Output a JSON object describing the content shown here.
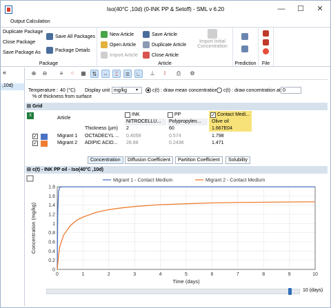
{
  "window": {
    "title": "Iso(40°C ,10d) (0-INK PP & Setoff) - SML v 6.20",
    "minimize": "—",
    "maximize": "☐",
    "close": "✕"
  },
  "ribbon_tabs": [
    "Output Calculation"
  ],
  "ribbon": {
    "package": {
      "label": "Package",
      "items": [
        "Duplicate Package",
        "Close Package",
        "Save Package As",
        "Save All Packages",
        "Package Details"
      ]
    },
    "article": {
      "label": "Article",
      "items": [
        "New Article",
        "Open Article",
        "Import Article",
        "Save Article",
        "Duplicate Article",
        "Close Article",
        "Import Initial Concentration"
      ]
    },
    "prediction": {
      "label": "Prediction"
    },
    "file": {
      "label": "File"
    }
  },
  "left_pane": {
    "arrow": "«",
    "selected": ",10d)"
  },
  "params": {
    "temperature_label": "Temperature :",
    "temperature_value": "40",
    "temperature_unit": "(°C)",
    "display_unit_label": "Display unit",
    "display_unit_value": "mg/kg",
    "radio1_label": "c(t) : draw mean concentration",
    "radio2_label": "c(t) : draw concentration at",
    "radio2_value": "0",
    "radio2_suffix": "% of thickness from surface"
  },
  "grid": {
    "title": "Grid",
    "article_header": "Article",
    "layers": [
      {
        "name": "INK",
        "material": "NITROCELLU...",
        "thickness": "2",
        "checked": false
      },
      {
        "name": "PP",
        "material": "Polypropylen...",
        "thickness": "60",
        "checked": false
      },
      {
        "name": "Contact Medi...",
        "material": "Olive oil",
        "thickness": "1.667E04",
        "checked": true
      }
    ],
    "thickness_label": "Thickness (µm)",
    "migrants": [
      {
        "name": "Migrant 1",
        "color": "#4a72c4",
        "substance": "OCTADECYL ...",
        "values": [
          "0.4058",
          "0.574",
          "1.798"
        ]
      },
      {
        "name": "Migrant 2",
        "color": "#ed7d31",
        "substance": "ADIPIC ACID...",
        "values": [
          "28.88",
          "0.2438",
          "1.471"
        ]
      }
    ]
  },
  "bottom_tabs": [
    "Concentration",
    "Diffusion Coefficient",
    "Partition Coefficient",
    "Solubility"
  ],
  "chart_header": "c(t) - INK PP oil - Iso(40°C ,10d)",
  "time_value": "10 (days)",
  "chart_data": {
    "type": "line",
    "xlabel": "Time (days)",
    "ylabel": "Concentration (mg/kg)",
    "xlim": [
      0,
      10
    ],
    "ylim": [
      0,
      1.8
    ],
    "xticks": [
      "0",
      "1",
      "2",
      "3",
      "4",
      "5",
      "6",
      "7",
      "8",
      "9",
      "10"
    ],
    "yticks": [
      "0",
      "0.2",
      "0.4",
      "0.6",
      "0.8",
      "1",
      "1.2",
      "1.4",
      "1.6",
      "1.8"
    ],
    "legend_position": "top",
    "series": [
      {
        "name": "Migrant 1 - Contact Medium",
        "color": "#4a72c4",
        "x": [
          0,
          0.02,
          0.05,
          0.1,
          0.2,
          0.5,
          1,
          2,
          3,
          4,
          5,
          6,
          7,
          8,
          9,
          10
        ],
        "y": [
          0,
          1.2,
          1.7,
          1.79,
          1.798,
          1.798,
          1.798,
          1.798,
          1.798,
          1.798,
          1.798,
          1.798,
          1.798,
          1.798,
          1.798,
          1.798
        ]
      },
      {
        "name": "Migrant 2 - Contact Medium",
        "color": "#ed7d31",
        "x": [
          0,
          0.05,
          0.1,
          0.25,
          0.5,
          0.75,
          1,
          1.5,
          2,
          2.5,
          3,
          4,
          5,
          6,
          7,
          8,
          9,
          10
        ],
        "y": [
          0,
          0.3,
          0.5,
          0.75,
          0.95,
          1.07,
          1.14,
          1.24,
          1.3,
          1.34,
          1.37,
          1.41,
          1.43,
          1.447,
          1.457,
          1.463,
          1.468,
          1.471
        ]
      }
    ]
  }
}
